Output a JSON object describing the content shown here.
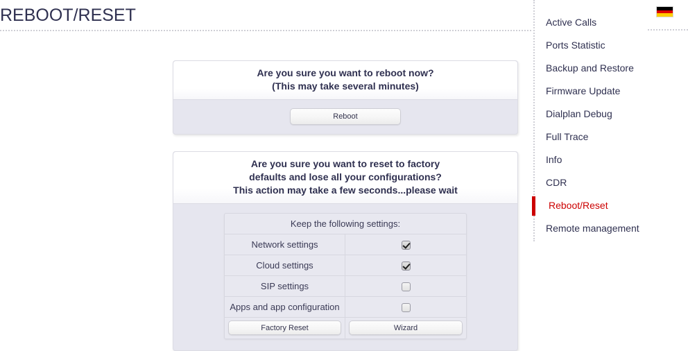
{
  "page": {
    "title": "REBOOT/RESET"
  },
  "reboot_panel": {
    "heading_line1": "Are you sure you want to reboot now?",
    "heading_line2": "(This may take several minutes)",
    "reboot_button": "Reboot"
  },
  "reset_panel": {
    "heading_line1": "Are you sure you want to reset to factory",
    "heading_line2": "defaults and lose all your configurations?",
    "heading_line3": "This action may take a few seconds...please wait",
    "table_header": "Keep the following settings:",
    "rows": [
      {
        "label": "Network settings",
        "checked": true
      },
      {
        "label": "Cloud settings",
        "checked": true
      },
      {
        "label": "SIP settings",
        "checked": false
      },
      {
        "label": "Apps and app configuration",
        "checked": false
      }
    ],
    "factory_reset_button": "Factory Reset",
    "wizard_button": "Wizard"
  },
  "sidebar": {
    "items": [
      {
        "label": "Active Calls",
        "active": false
      },
      {
        "label": "Ports Statistic",
        "active": false
      },
      {
        "label": "Backup and Restore",
        "active": false
      },
      {
        "label": "Firmware Update",
        "active": false
      },
      {
        "label": "Dialplan Debug",
        "active": false
      },
      {
        "label": "Full Trace",
        "active": false
      },
      {
        "label": "Info",
        "active": false
      },
      {
        "label": "CDR",
        "active": false
      },
      {
        "label": "Reboot/Reset",
        "active": true
      },
      {
        "label": "Remote management",
        "active": false
      }
    ],
    "flag": "germany-flag-icon"
  },
  "colors": {
    "accent_red": "#cc0000",
    "text_navy": "#2f3050",
    "panel_body": "#e6e6ef"
  }
}
